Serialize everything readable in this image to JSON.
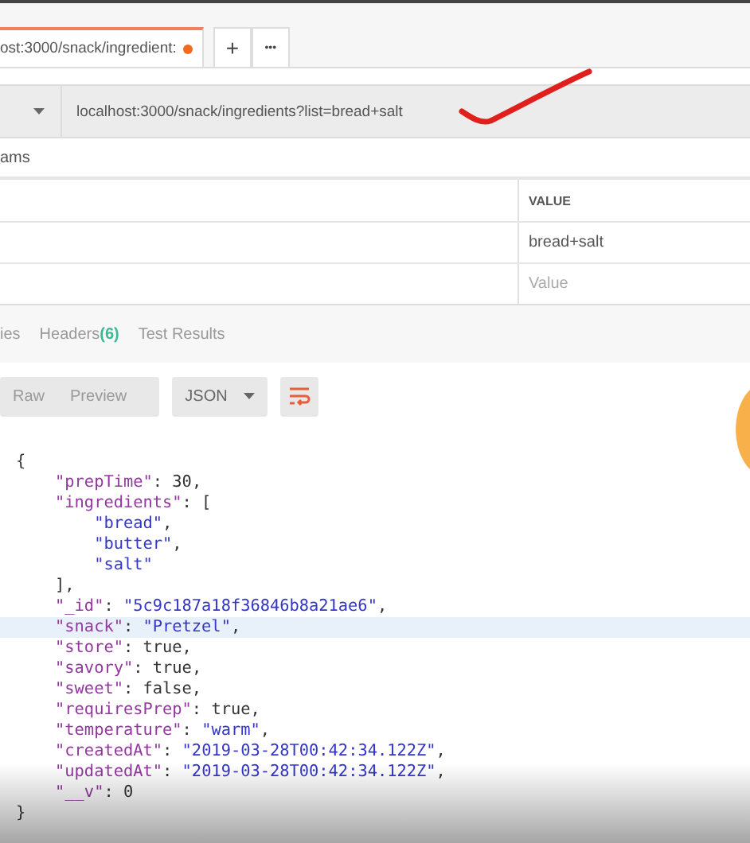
{
  "tabs": [
    {
      "label": "ost:3000/snack/ingredient:",
      "selected": true,
      "unsaved": true
    }
  ],
  "new_tab_button": "+",
  "more_button": "•••",
  "request": {
    "url": "localhost:3000/snack/ingredients?list=bread+salt"
  },
  "params_label": "ams",
  "params_table": {
    "column_header": "VALUE",
    "rows": [
      {
        "value": "bread+salt"
      },
      {
        "placeholder": "Value"
      }
    ]
  },
  "response_tabs": [
    {
      "label": "ies",
      "selected": false
    },
    {
      "label": "Headers",
      "count": "(6)",
      "selected": false
    },
    {
      "label": "Test Results",
      "selected": false
    }
  ],
  "view_modes": [
    {
      "label": "Raw",
      "selected": false
    },
    {
      "label": "Preview",
      "selected": false
    }
  ],
  "format_dropdown": "JSON",
  "code_lines": [
    {
      "highlighted": false,
      "tokens": [
        {
          "text": "{",
          "kind": "punct"
        }
      ]
    },
    {
      "highlighted": false,
      "tokens": [
        {
          "text": "    \"prepTime\"",
          "kind": "key"
        },
        {
          "text": ": ",
          "kind": "punct"
        },
        {
          "text": "30",
          "kind": "literal"
        },
        {
          "text": ",",
          "kind": "punct"
        }
      ]
    },
    {
      "highlighted": false,
      "tokens": [
        {
          "text": "    \"ingredients\"",
          "kind": "key"
        },
        {
          "text": ": [",
          "kind": "punct"
        }
      ]
    },
    {
      "highlighted": false,
      "tokens": [
        {
          "text": "        \"bread\"",
          "kind": "string"
        },
        {
          "text": ",",
          "kind": "punct"
        }
      ]
    },
    {
      "highlighted": false,
      "tokens": [
        {
          "text": "        \"butter\"",
          "kind": "string"
        },
        {
          "text": ",",
          "kind": "punct"
        }
      ]
    },
    {
      "highlighted": false,
      "tokens": [
        {
          "text": "        \"salt\"",
          "kind": "string"
        }
      ]
    },
    {
      "highlighted": false,
      "tokens": [
        {
          "text": "    ],",
          "kind": "punct"
        }
      ]
    },
    {
      "highlighted": false,
      "tokens": [
        {
          "text": "    \"_id\"",
          "kind": "key"
        },
        {
          "text": ": ",
          "kind": "punct"
        },
        {
          "text": "\"5c9c187a18f36846b8a21ae6\"",
          "kind": "string"
        },
        {
          "text": ",",
          "kind": "punct"
        }
      ]
    },
    {
      "highlighted": true,
      "tokens": [
        {
          "text": "    \"snack\"",
          "kind": "key"
        },
        {
          "text": ": ",
          "kind": "punct"
        },
        {
          "text": "\"Pretzel\"",
          "kind": "string"
        },
        {
          "text": ",",
          "kind": "punct"
        }
      ]
    },
    {
      "highlighted": false,
      "tokens": [
        {
          "text": "    \"store\"",
          "kind": "key"
        },
        {
          "text": ": ",
          "kind": "punct"
        },
        {
          "text": "true",
          "kind": "literal"
        },
        {
          "text": ",",
          "kind": "punct"
        }
      ]
    },
    {
      "highlighted": false,
      "tokens": [
        {
          "text": "    \"savory\"",
          "kind": "key"
        },
        {
          "text": ": ",
          "kind": "punct"
        },
        {
          "text": "true",
          "kind": "literal"
        },
        {
          "text": ",",
          "kind": "punct"
        }
      ]
    },
    {
      "highlighted": false,
      "tokens": [
        {
          "text": "    \"sweet\"",
          "kind": "key"
        },
        {
          "text": ": ",
          "kind": "punct"
        },
        {
          "text": "false",
          "kind": "literal"
        },
        {
          "text": ",",
          "kind": "punct"
        }
      ]
    },
    {
      "highlighted": false,
      "tokens": [
        {
          "text": "    \"requiresPrep\"",
          "kind": "key"
        },
        {
          "text": ": ",
          "kind": "punct"
        },
        {
          "text": "true",
          "kind": "literal"
        },
        {
          "text": ",",
          "kind": "punct"
        }
      ]
    },
    {
      "highlighted": false,
      "tokens": [
        {
          "text": "    \"temperature\"",
          "kind": "key"
        },
        {
          "text": ": ",
          "kind": "punct"
        },
        {
          "text": "\"warm\"",
          "kind": "string"
        },
        {
          "text": ",",
          "kind": "punct"
        }
      ]
    },
    {
      "highlighted": false,
      "tokens": [
        {
          "text": "    \"createdAt\"",
          "kind": "key"
        },
        {
          "text": ": ",
          "kind": "punct"
        },
        {
          "text": "\"2019-03-28T00:42:34.122Z\"",
          "kind": "string"
        },
        {
          "text": ",",
          "kind": "punct"
        }
      ]
    },
    {
      "highlighted": false,
      "tokens": [
        {
          "text": "    \"updatedAt\"",
          "kind": "key"
        },
        {
          "text": ": ",
          "kind": "punct"
        },
        {
          "text": "\"2019-03-28T00:42:34.122Z\"",
          "kind": "string"
        },
        {
          "text": ",",
          "kind": "punct"
        }
      ]
    },
    {
      "highlighted": false,
      "tokens": [
        {
          "text": "    \"__v\"",
          "kind": "key"
        },
        {
          "text": ": ",
          "kind": "punct"
        },
        {
          "text": "0",
          "kind": "literal"
        }
      ]
    },
    {
      "highlighted": false,
      "tokens": [
        {
          "text": "}",
          "kind": "punct"
        }
      ]
    }
  ]
}
